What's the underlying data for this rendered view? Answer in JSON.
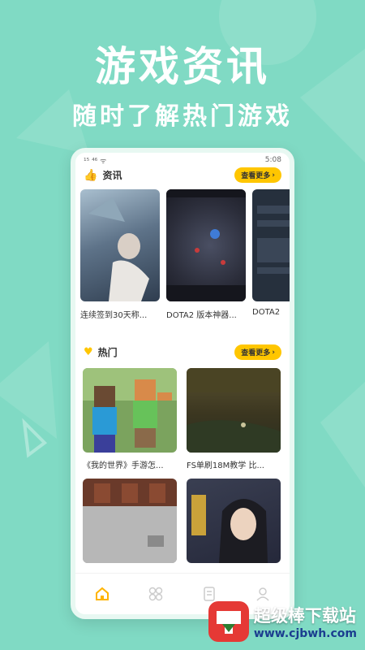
{
  "hero": {
    "title": "游戏资讯",
    "subtitle": "随时了解热门游戏"
  },
  "status_bar": {
    "left": "¹⁵ ⁴⁶ ᯤ",
    "time": "5:08"
  },
  "news_section": {
    "title": "资讯",
    "icon": "thumbs-up-icon",
    "more_label": "查看更多",
    "items": [
      {
        "caption": "连续签到30天称..."
      },
      {
        "caption": "DOTA2 版本神器..."
      },
      {
        "caption": "DOTA2"
      }
    ]
  },
  "hot_section": {
    "title": "热门",
    "icon": "heart-icon",
    "more_label": "查看更多",
    "items": [
      {
        "caption": "《我的世界》手游怎..."
      },
      {
        "caption": "FS单刷18M教学 比..."
      },
      {
        "caption": ""
      },
      {
        "caption": ""
      }
    ]
  },
  "tabbar": {
    "items": [
      {
        "icon": "home-icon",
        "active": true
      },
      {
        "icon": "grid-icon",
        "active": false
      },
      {
        "icon": "document-icon",
        "active": false
      },
      {
        "icon": "user-icon",
        "active": false
      }
    ]
  },
  "watermark": {
    "text": "超级棒下载站",
    "url": "www.cjbwh.com"
  },
  "colors": {
    "background": "#80dac4",
    "accent": "#ffc600",
    "active_tab": "#ffb400"
  }
}
